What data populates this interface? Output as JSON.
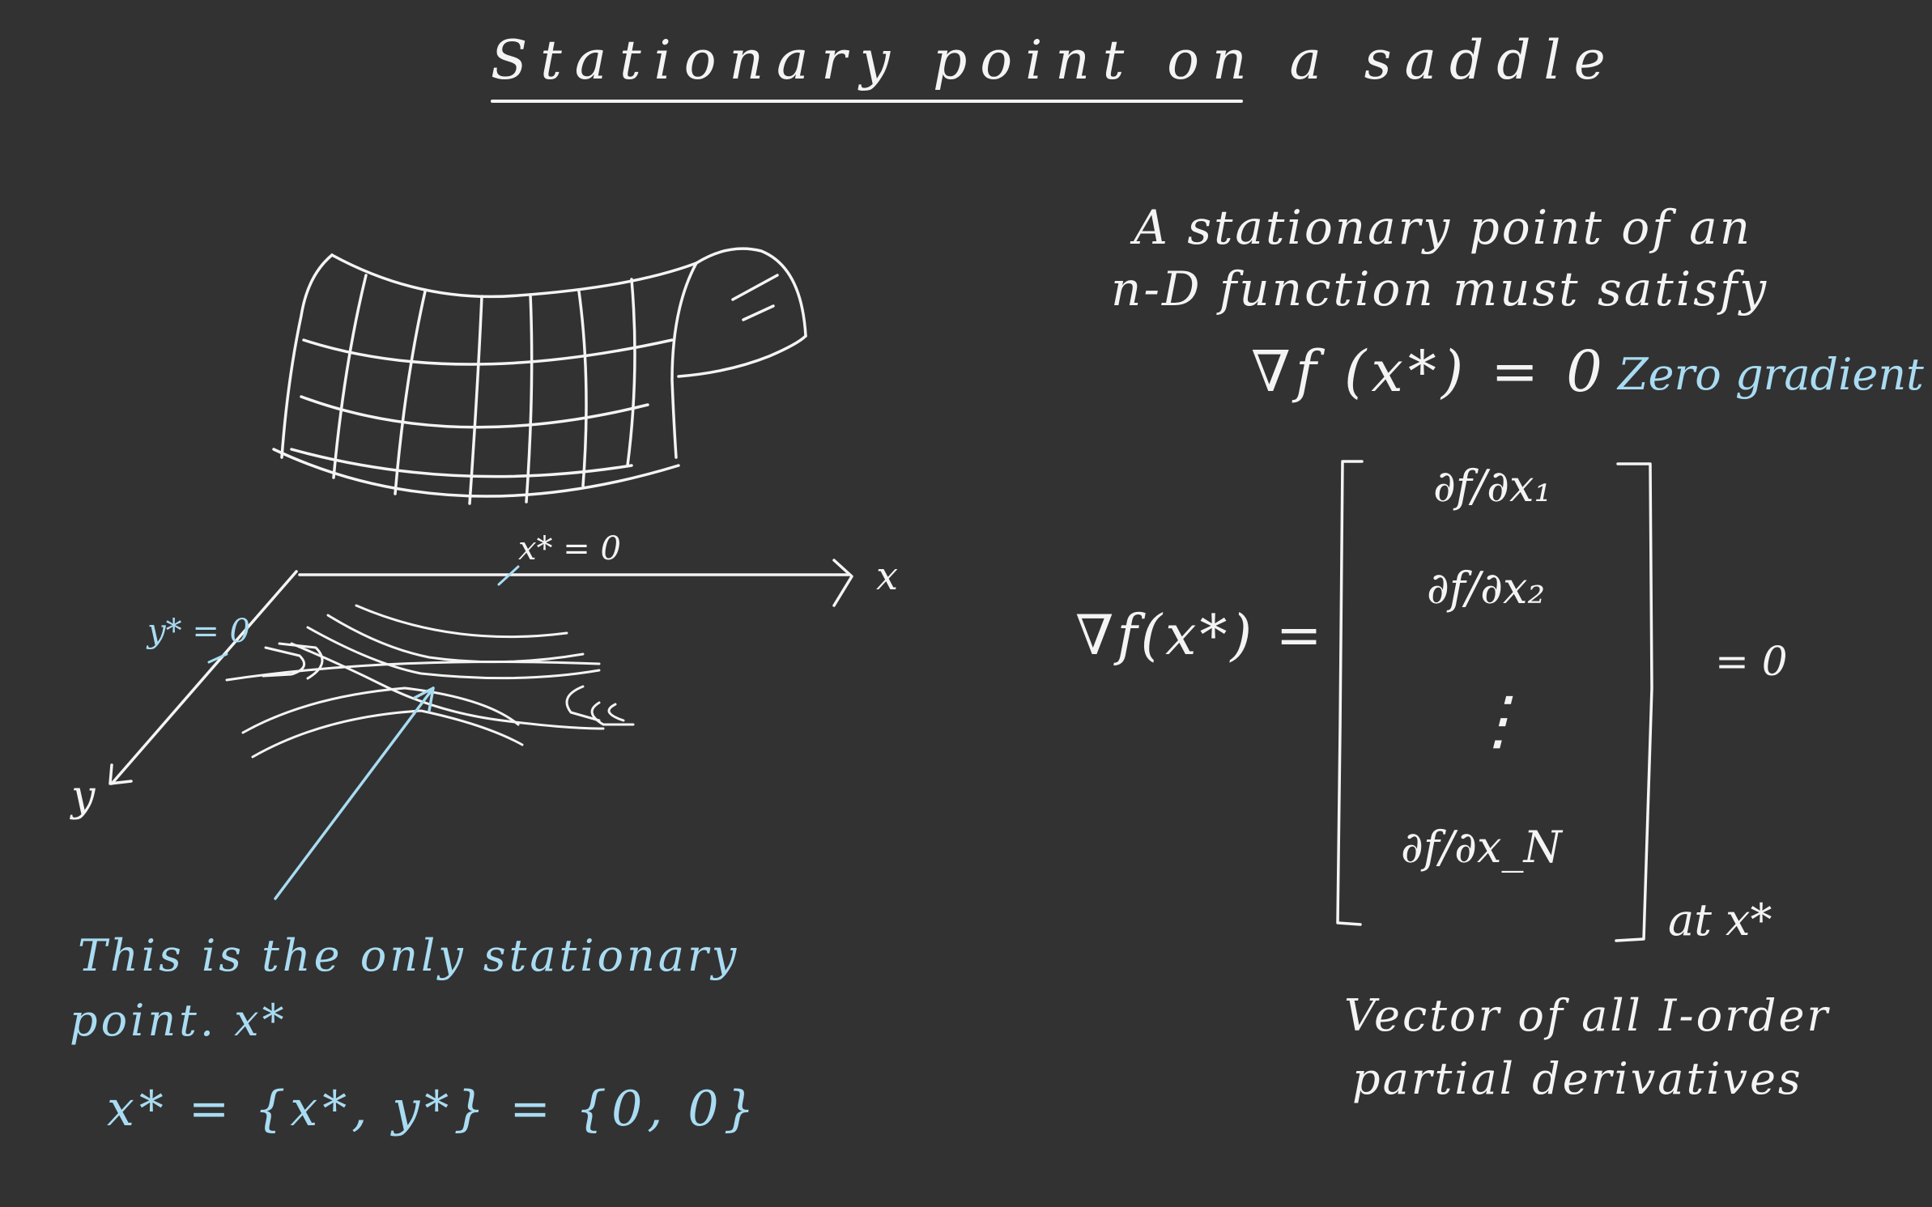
{
  "title": "Stationary point on a saddle",
  "axes": {
    "x_label": "x",
    "y_label": "y",
    "x_star": "x* = 0",
    "y_star": "y* = 0"
  },
  "annotation": {
    "line1": "This is the only stationary",
    "line2": "point. x*",
    "equation": "x* = {x*, y*} = {0, 0}"
  },
  "condition": {
    "line1": "A  stationary  point  of  an",
    "line2": "n-D  function  must  satisfy",
    "gradient_eq": "∇f (x*) = 0",
    "gradient_label": "Zero gradient"
  },
  "gradient_vector": {
    "lhs": "∇f(x*) =",
    "entries": [
      "∂f/∂x₁",
      "∂f/∂x₂",
      "⋮",
      "∂f/∂x_N"
    ],
    "rhs": "= 0",
    "at": "at x*"
  },
  "footnote": {
    "line1": "Vector  of  all  I-order",
    "line2": "partial  derivatives"
  },
  "colors": {
    "background": "#323232",
    "chalk": "#f4f4f4",
    "highlight": "#a9dcf2"
  }
}
